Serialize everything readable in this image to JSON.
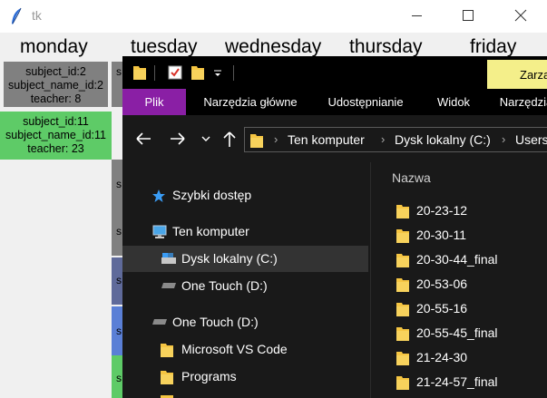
{
  "tk": {
    "title": "tk",
    "days": [
      "monday",
      "tuesday",
      "wednesday",
      "thursday",
      "friday"
    ],
    "lessons": [
      {
        "subject_id": "subject_id:2",
        "subject_name_id": "subject_name_id:2",
        "teacher": "teacher: 8",
        "color": "#808080"
      },
      {
        "subject_id": "subject_id:11",
        "subject_name_id": "subject_name_id:11",
        "teacher": "teacher: 23",
        "color": "#5ecb67"
      }
    ],
    "hidden_cells": [
      "s",
      "s",
      "s",
      "s",
      "s",
      "s",
      "s",
      "s"
    ]
  },
  "explorer": {
    "context_tab": "Zarząd",
    "ribbon_tabs": [
      "Plik",
      "Narzędzia główne",
      "Udostępnianie",
      "Widok",
      "Narzędzia"
    ],
    "breadcrumbs": [
      "Ten komputer",
      "Dysk lokalny (C:)",
      "Users"
    ],
    "nav_items": [
      {
        "label": "Szybki dostęp",
        "icon": "star-icon"
      },
      {
        "label": "Ten komputer",
        "icon": "computer-icon"
      },
      {
        "label": "Dysk lokalny (C:)",
        "icon": "drive-icon"
      },
      {
        "label": "One Touch (D:)",
        "icon": "drive-icon"
      },
      {
        "label": "One Touch (D:)",
        "icon": "drive-icon"
      },
      {
        "label": "Microsoft VS Code",
        "icon": "folder-icon"
      },
      {
        "label": "Programs",
        "icon": "folder-icon"
      }
    ],
    "column_header": "Nazwa",
    "files": [
      "20-23-12",
      "20-30-11",
      "20-30-44_final",
      "20-53-06",
      "20-55-16",
      "20-55-45_final",
      "21-24-30",
      "21-24-57_final"
    ]
  }
}
